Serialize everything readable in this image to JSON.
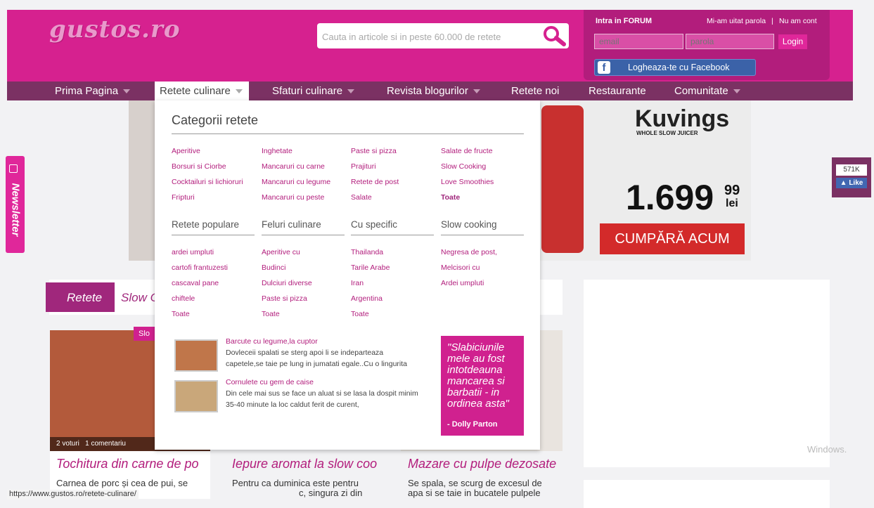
{
  "header": {
    "logo": "gustos.ro",
    "search_placeholder": "Cauta in articole si in peste 60.000 de retete"
  },
  "forum": {
    "title": "Intra in FORUM",
    "forgot": "Mi-am uitat parola",
    "sep": "|",
    "no_account": "Nu am cont",
    "email_placeholder": "email",
    "password_placeholder": "parola",
    "login": "Login",
    "facebook": "Logheaza-te cu Facebook"
  },
  "nav": {
    "items": [
      "Prima Pagina",
      "Retete culinare",
      "Sfaturi culinare",
      "Revista blogurilor",
      "Retete noi",
      "Restaurante",
      "Comunitate"
    ]
  },
  "dropdown": {
    "heading": "Categorii retete",
    "categories": [
      [
        "Aperitive",
        "Borsuri si Ciorbe",
        "Cocktailuri si lichioruri",
        "Fripturi"
      ],
      [
        "Inghetate",
        "Mancaruri cu carne",
        "Mancaruri cu legume",
        "Mancaruri cu peste"
      ],
      [
        "Paste si pizza",
        "Prajituri",
        "Retete de post",
        "Salate"
      ],
      [
        "Salate de fructe",
        "Slow Cooking",
        "Love Smoothies",
        "Toate"
      ]
    ],
    "sub_headings": [
      "Retete populare",
      "Feluri culinare",
      "Cu specific",
      "Slow cooking"
    ],
    "sub_links": [
      [
        "ardei umpluti",
        "cartofi frantuzesti",
        "cascaval pane",
        "chiftele",
        "Toate"
      ],
      [
        "Aperitive cu",
        "Budinci",
        "Dulciuri diverse",
        "Paste si pizza",
        "Toate"
      ],
      [
        "Thailanda",
        "Tarile Arabe",
        "Iran",
        "Argentina",
        "Toate"
      ],
      [
        "Negresa de post,",
        "Melcisori cu",
        "Ardei umpluti"
      ]
    ],
    "recipes": [
      {
        "title": "Barcute cu legume,la cuptor",
        "text1": "Dovleceii spalati se sterg apoi li se indeparteaza",
        "text2": "capetele,se taie pe lung in jumatati egale..Cu o lingurita"
      },
      {
        "title": "Cornulete cu gem de caise",
        "text1": "Din cele mai sus se face un aluat si se lasa la dospit minim",
        "text2": "35-40 minute la loc caldut ferit de curent,"
      }
    ],
    "quote": "\"Slabiciunile mele au fost intotdeauna mancarea si barbatii - in ordinea asta\"",
    "quote_author": "- Dolly Parton"
  },
  "banner": {
    "brand": "Kuvings",
    "tagline": "WHOLE SLOW JUICER",
    "price": "1.699",
    "price_cents": "99",
    "price_unit": "lei",
    "cta": "CUMPĂRĂ ACUM"
  },
  "newsletter": "Newsletter",
  "like": {
    "count": "571K",
    "label": "Like"
  },
  "section": {
    "tab": "Retete",
    "title": "Slow C"
  },
  "cards": [
    {
      "badge": "Slo",
      "meta": "2 voturi   1 comentariu",
      "title": "Tochitura din carne de po",
      "text1": "Carnea de porc și cea de pui, se"
    },
    {
      "title": "Iepure aromat la slow coo",
      "text1": "Pentru ca duminica este pentru",
      "text2": "c, singura zi din"
    },
    {
      "title": "Mazare cu pulpe dezosate",
      "text1": "Se spala, se scurg de excesul de",
      "text2": "apa si se taie in bucatele pulpele"
    }
  ],
  "status_url": "https://www.gustos.ro/retete-culinare/",
  "windows_text": "Windows."
}
